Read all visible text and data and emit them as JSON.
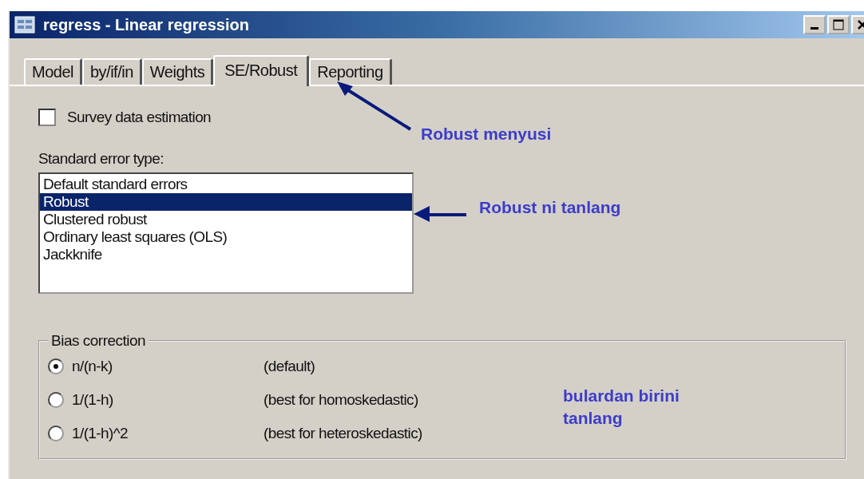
{
  "window": {
    "title": "regress - Linear regression"
  },
  "tabs": [
    {
      "label": "Model",
      "selected": false
    },
    {
      "label": "by/if/in",
      "selected": false
    },
    {
      "label": "Weights",
      "selected": false
    },
    {
      "label": "SE/Robust",
      "selected": true
    },
    {
      "label": "Reporting",
      "selected": false
    }
  ],
  "survey_checkbox": {
    "label": "Survey data estimation",
    "checked": false
  },
  "se_type": {
    "label": "Standard error type:",
    "items": [
      {
        "label": "Default standard errors",
        "selected": false
      },
      {
        "label": "Robust",
        "selected": true
      },
      {
        "label": "Clustered robust",
        "selected": false
      },
      {
        "label": "Ordinary least squares (OLS)",
        "selected": false
      },
      {
        "label": "Jackknife",
        "selected": false
      }
    ]
  },
  "bias_correction": {
    "title": "Bias correction",
    "options": [
      {
        "label": "n/(n-k)",
        "note": "(default)",
        "selected": true
      },
      {
        "label": "1/(1-h)",
        "note": "(best for homoskedastic)",
        "selected": false
      },
      {
        "label": "1/(1-h)^2",
        "note": "(best for heteroskedastic)",
        "selected": false
      }
    ]
  },
  "annotations": [
    {
      "text": "Robust menyusi"
    },
    {
      "text": "Robust ni tanlang"
    },
    {
      "text": "bulardan birini tanlang"
    }
  ]
}
